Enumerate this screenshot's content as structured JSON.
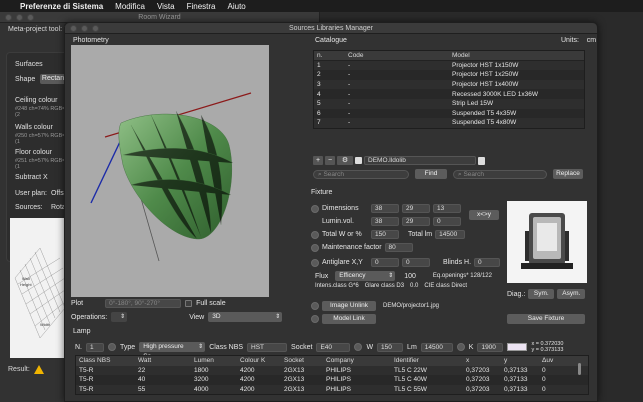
{
  "menubar": {
    "apple": "",
    "app_name": "Preferenze di Sistema",
    "items": [
      "Modifica",
      "Vista",
      "Finestra",
      "Aiuto"
    ]
  },
  "room_wizard": {
    "title": "Room Wizard",
    "meta_label": "Meta-project tool: \"R",
    "surfaces_label": "Surfaces",
    "shape_label": "Shape",
    "shape_value": "Rectan",
    "ceiling_label": "Ceiling colour",
    "ceiling_sub": "#248 ch=74% RGB=(2",
    "walls_label": "Walls colour",
    "walls_sub": "#250 ch=57% RGB=(1",
    "floor_label": "Floor colour",
    "floor_sub": "#251 ch=57% RGB=(1",
    "subtract_label": "Subtract X",
    "userplan_label": "User plan:",
    "userplan_value": "Offs",
    "sources_label": "Sources:",
    "sources_value": "Rota",
    "preview_labels": [
      "Wall",
      "Height",
      "Width"
    ],
    "result_label": "Result:"
  },
  "slm": {
    "title": "Sources Libraries Manager",
    "photometry_label": "Photometry",
    "catalogue_label": "Catalogue",
    "units_label": "Units:",
    "units_value": "cm",
    "plot_label": "Plot",
    "plot_value": "0°-180°, 90°-270°",
    "full_scale_label": "Full scale",
    "operations_label": "Operations:",
    "view_label": "View",
    "view_value": "3D",
    "catalogue": {
      "columns": [
        "n.",
        "Code",
        "Model"
      ],
      "rows": [
        {
          "n": "1",
          "code": "-",
          "model": "Projector HST 1x150W"
        },
        {
          "n": "2",
          "code": "-",
          "model": "Projector HST 1x250W"
        },
        {
          "n": "3",
          "code": "-",
          "model": "Projector HST 1x400W"
        },
        {
          "n": "4",
          "code": "-",
          "model": "Recessed 3000K LED 1x36W"
        },
        {
          "n": "5",
          "code": "-",
          "model": "Strip Led 15W"
        },
        {
          "n": "6",
          "code": "-",
          "model": "Suspended T5  4x35W"
        },
        {
          "n": "7",
          "code": "-",
          "model": "Suspended T5  4x80W"
        }
      ],
      "library_file": "DEMO.lldolib",
      "search_placeholder": "Search",
      "find_label": "Find",
      "replace_search_placeholder": "Search",
      "replace_label": "Replace"
    },
    "fixture": {
      "label": "Fixture",
      "dimensions_label": "Dimensions",
      "dimensions": [
        "38",
        "29",
        "13"
      ],
      "lumin_label": "Lumin.vol.",
      "lumin": [
        "38",
        "29",
        "0"
      ],
      "swap_label": "x<>y",
      "total_w_label": "Total W or %",
      "total_w_value": "150",
      "total_lm_label": "Total lm",
      "total_lm_value": "14500",
      "maintenance_label": "Maintenance factor",
      "maintenance_value": "80",
      "antiglare_label": "Antiglare X,Y",
      "antiglare": [
        "0",
        "0"
      ],
      "blinds_label": "Blinds H.",
      "blinds_value": "0",
      "flux_label": "Flux",
      "flux_value": "Efficency",
      "flux_number": "100",
      "eq_openings": "Eq.openings* 128/122",
      "intens_class": "Intens.class G*6",
      "glare_class": "Glare class D3",
      "glare_value": "0.0",
      "cie_class": "CIE class Direct",
      "image_unlink_label": "Image Unlink",
      "image_path": "DEMO/projector1.jpg",
      "model_link_label": "Model Link",
      "diag_label": "Diag.:",
      "sym_label": "Sym.",
      "asym_label": "Asym.",
      "save_label": "Save Fixture"
    },
    "lamp": {
      "label": "Lamp",
      "n_label": "N.",
      "n_value": "1",
      "type_label": "Type",
      "type_value": "High pressure So...",
      "class_nbs_label": "Class NBS",
      "class_nbs_value": "HST",
      "socket_label": "Socket",
      "socket_value": "E40",
      "w_label": "W",
      "w_value": "150",
      "lm_label": "Lm",
      "lm_value": "14500",
      "k_label": "K",
      "k_value": "1900",
      "xy_readout": [
        "x = 0.372030",
        "y = 0.373133"
      ],
      "columns": [
        "Class NBS",
        "Watt",
        "Lumen",
        "Colour K",
        "Socket",
        "Company",
        "Identifier",
        "x",
        "y",
        "Δuv"
      ],
      "rows": [
        {
          "nbs": "T5-R",
          "watt": "22",
          "lumen": "1800",
          "k": "4200",
          "socket": "2GX13",
          "company": "PHILIPS",
          "id": "TL5 C 22W",
          "x": "0,37203",
          "y": "0,37133",
          "uv": "0"
        },
        {
          "nbs": "T5-R",
          "watt": "40",
          "lumen": "3200",
          "k": "4200",
          "socket": "2GX13",
          "company": "PHILIPS",
          "id": "TL5 C 40W",
          "x": "0,37203",
          "y": "0,37133",
          "uv": "0"
        },
        {
          "nbs": "T5-R",
          "watt": "55",
          "lumen": "4000",
          "k": "4200",
          "socket": "2GX13",
          "company": "PHILIPS",
          "id": "TL5 C 55W",
          "x": "0,37203",
          "y": "0,37133",
          "uv": "0"
        }
      ]
    }
  }
}
